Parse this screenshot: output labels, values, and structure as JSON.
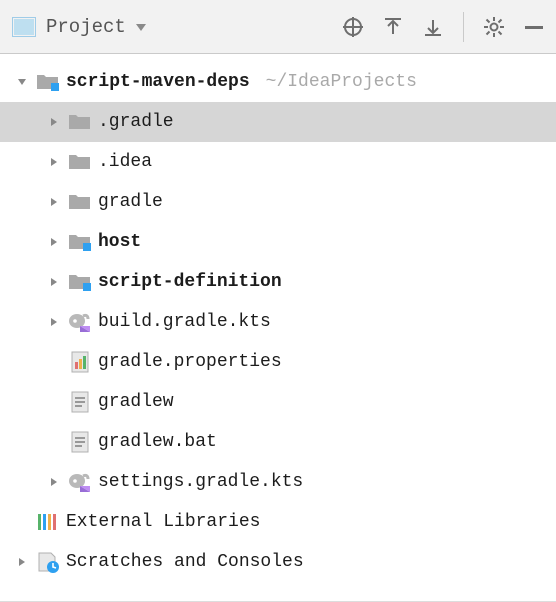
{
  "header": {
    "title": "Project"
  },
  "tree": {
    "root": {
      "label": "script-maven-deps",
      "path": "~/IdeaProjects"
    },
    "nodes": [
      {
        "label": ".gradle"
      },
      {
        "label": ".idea"
      },
      {
        "label": "gradle"
      },
      {
        "label": "host"
      },
      {
        "label": "script-definition"
      },
      {
        "label": "build.gradle.kts"
      },
      {
        "label": "gradle.properties"
      },
      {
        "label": "gradlew"
      },
      {
        "label": "gradlew.bat"
      },
      {
        "label": "settings.gradle.kts"
      }
    ],
    "external": "External Libraries",
    "scratches": "Scratches and Consoles"
  }
}
